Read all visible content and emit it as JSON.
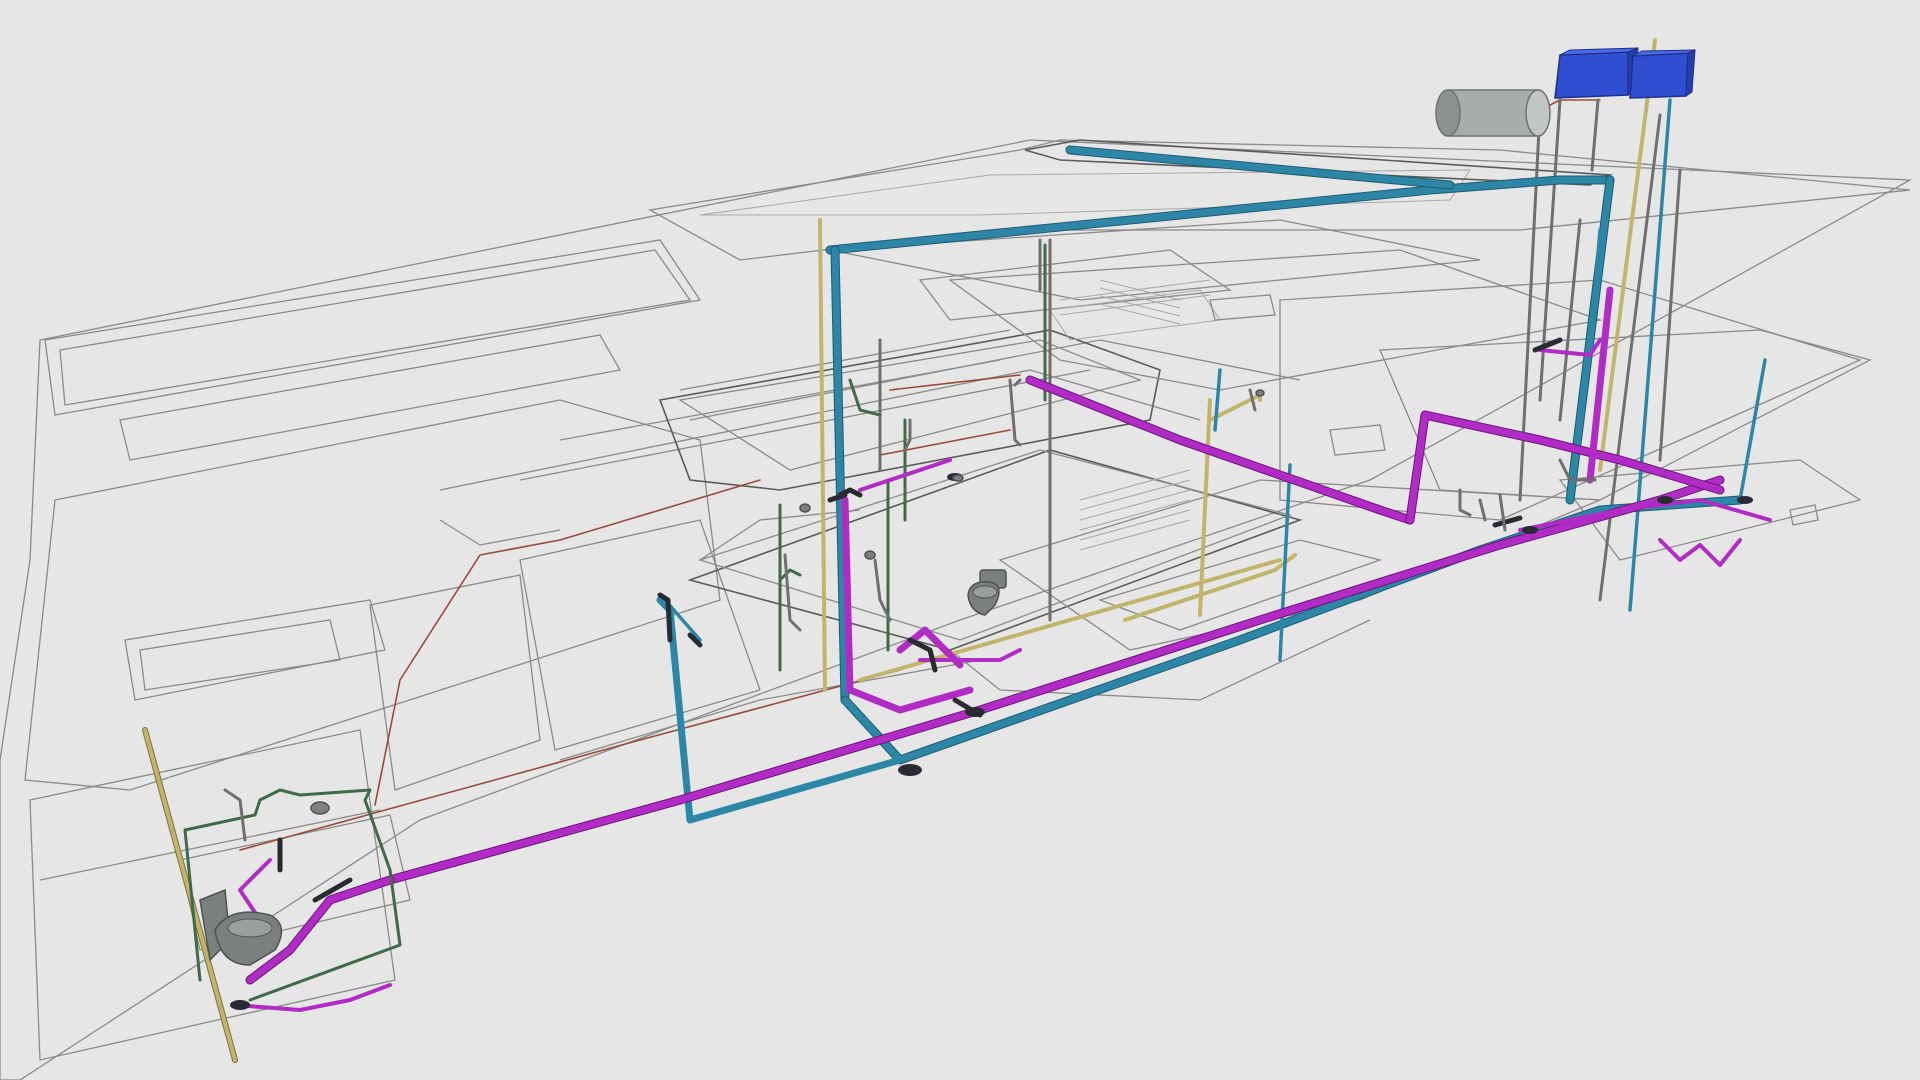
{
  "viewer": {
    "background_color": "#e6e6e6",
    "content": "3d-plumbing-model"
  },
  "colors": {
    "cold_water": "#2e86a6",
    "drain": "#b02cc4",
    "vent": "#c2b46a",
    "hot_water": "#9b4a3a",
    "gas": "#3f6a4a",
    "floor_outline": "#8a8a8a",
    "tank": "#2f4fd0",
    "cylinder": "#a9acad"
  },
  "fixtures": {
    "water_tanks": 2,
    "cylinder_tanks": 1,
    "toilets": 2
  }
}
